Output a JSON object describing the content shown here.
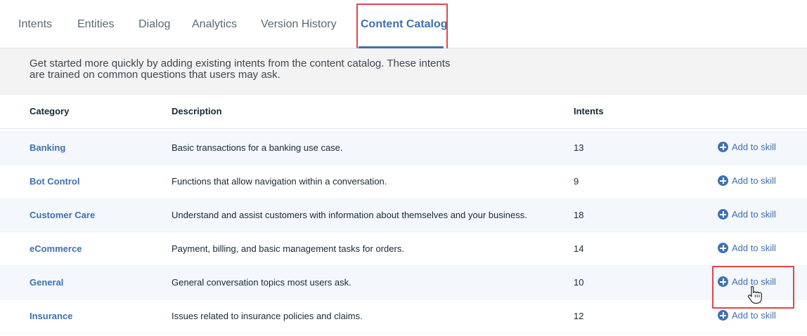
{
  "tabs": [
    {
      "label": "Intents"
    },
    {
      "label": "Entities"
    },
    {
      "label": "Dialog"
    },
    {
      "label": "Analytics"
    },
    {
      "label": "Version History"
    },
    {
      "label": "Content Catalog",
      "active": true
    }
  ],
  "banner": {
    "line1": "Get started more quickly by adding existing intents from the content catalog. These intents",
    "line2": "are trained on common questions that users may ask."
  },
  "table": {
    "headers": {
      "category": "Category",
      "description": "Description",
      "intents": "Intents"
    },
    "add_label": "Add to skill",
    "rows": [
      {
        "category": "Banking",
        "description": "Basic transactions for a banking use case.",
        "intents": "13"
      },
      {
        "category": "Bot Control",
        "description": "Functions that allow navigation within a conversation.",
        "intents": "9"
      },
      {
        "category": "Customer Care",
        "description": "Understand and assist customers with information about themselves and your business.",
        "intents": "18"
      },
      {
        "category": "eCommerce",
        "description": "Payment, billing, and basic management tasks for orders.",
        "intents": "14"
      },
      {
        "category": "General",
        "description": "General conversation topics most users ask.",
        "intents": "10"
      },
      {
        "category": "Insurance",
        "description": "Issues related to insurance policies and claims.",
        "intents": "12"
      }
    ]
  },
  "colors": {
    "accent": "#3d70b2",
    "highlight": "#e0454a",
    "row_alt": "#f4f7fb"
  },
  "icons": [
    "plus-circle-icon",
    "hand-cursor-icon"
  ]
}
